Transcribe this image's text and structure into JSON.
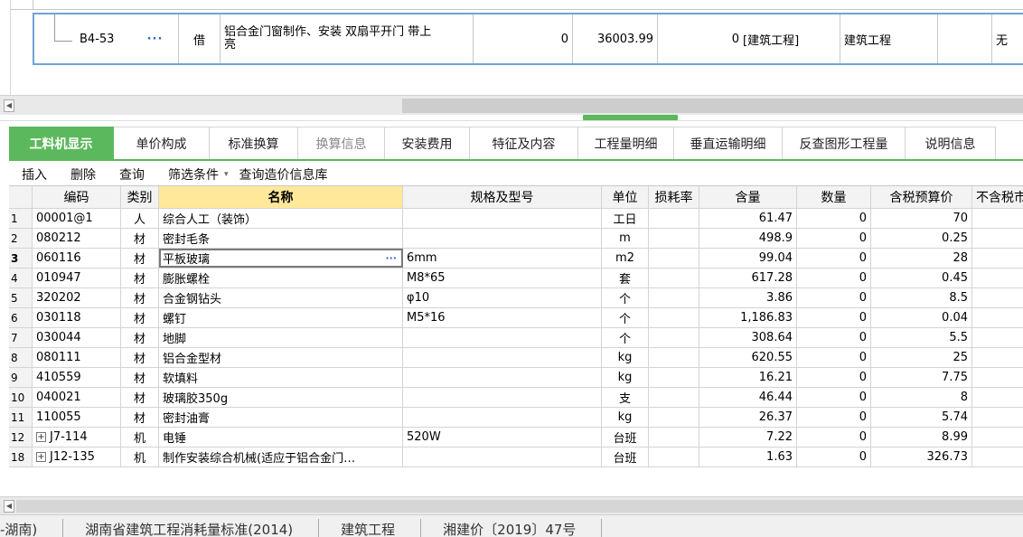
{
  "top_row": {
    "code": "B4-53",
    "dots": "···",
    "type": "借",
    "name_line1": "铝合金门窗制作、安装 双扇平开门 带上",
    "name_line2": "亮",
    "v1": "0",
    "v2": "36003.99",
    "v3": "0",
    "category": "[建筑工程]",
    "discipline": "建筑工程",
    "last": "无"
  },
  "tabs": [
    {
      "label": "工料机显示"
    },
    {
      "label": "单价构成"
    },
    {
      "label": "标准换算"
    },
    {
      "label": "换算信息"
    },
    {
      "label": "安装费用"
    },
    {
      "label": "特征及内容"
    },
    {
      "label": "工程量明细"
    },
    {
      "label": "垂直运输明细"
    },
    {
      "label": "反查图形工程量"
    },
    {
      "label": "说明信息"
    }
  ],
  "toolbar": {
    "insert": "插入",
    "delete": "删除",
    "query": "查询",
    "filter": "筛选条件",
    "caret": "▾",
    "query_price": "查询造价信息库"
  },
  "columns": {
    "code": "编码",
    "type": "类别",
    "name": "名称",
    "spec": "规格及型号",
    "unit": "单位",
    "loss": "损耗率",
    "content": "含量",
    "qty": "数量",
    "tax_price": "含税预算价",
    "notax_price": "不含税市"
  },
  "rows": [
    {
      "no": "1",
      "code": "00001@1",
      "type": "人",
      "name": "综合人工（装饰）",
      "spec": "",
      "unit": "工日",
      "content": "61.47",
      "qty": "0",
      "price": "70",
      "extra": ""
    },
    {
      "no": "2",
      "code": "080212",
      "type": "材",
      "name": "密封毛条",
      "spec": "",
      "unit": "m",
      "content": "498.9",
      "qty": "0",
      "price": "0.25",
      "extra": ""
    },
    {
      "no": "3",
      "code": "060116",
      "type": "材",
      "name": "平板玻璃",
      "spec": "6mm",
      "unit": "m2",
      "content": "99.04",
      "qty": "0",
      "price": "28",
      "extra": ""
    },
    {
      "no": "4",
      "code": "010947",
      "type": "材",
      "name": "膨胀螺栓",
      "spec": "M8*65",
      "unit": "套",
      "content": "617.28",
      "qty": "0",
      "price": "0.45",
      "extra": ""
    },
    {
      "no": "5",
      "code": "320202",
      "type": "材",
      "name": "合金钢钻头",
      "spec": "φ10",
      "unit": "个",
      "content": "3.86",
      "qty": "0",
      "price": "8.5",
      "extra": ""
    },
    {
      "no": "6",
      "code": "030118",
      "type": "材",
      "name": "螺钉",
      "spec": "M5*16",
      "unit": "个",
      "content": "1,186.83",
      "qty": "0",
      "price": "0.04",
      "extra": ""
    },
    {
      "no": "7",
      "code": "030044",
      "type": "材",
      "name": "地脚",
      "spec": "",
      "unit": "个",
      "content": "308.64",
      "qty": "0",
      "price": "5.5",
      "extra": ""
    },
    {
      "no": "8",
      "code": "080111",
      "type": "材",
      "name": "铝合金型材",
      "spec": "",
      "unit": "kg",
      "content": "620.55",
      "qty": "0",
      "price": "25",
      "extra": "2"
    },
    {
      "no": "9",
      "code": "410559",
      "type": "材",
      "name": "软填料",
      "spec": "",
      "unit": "kg",
      "content": "16.21",
      "qty": "0",
      "price": "7.75",
      "extra": ""
    },
    {
      "no": "10",
      "code": "040021",
      "type": "材",
      "name": "玻璃胶350g",
      "spec": "",
      "unit": "支",
      "content": "46.44",
      "qty": "0",
      "price": "8",
      "extra": ""
    },
    {
      "no": "11",
      "code": "110055",
      "type": "材",
      "name": "密封油膏",
      "spec": "",
      "unit": "kg",
      "content": "26.37",
      "qty": "0",
      "price": "5.74",
      "extra": ""
    },
    {
      "no": "12",
      "code": "J7-114",
      "type": "机",
      "name": "电锤",
      "spec": "520W",
      "unit": "台班",
      "content": "7.22",
      "qty": "0",
      "price": "8.99",
      "extra": ""
    },
    {
      "no": "18",
      "code": "J12-135",
      "type": "机",
      "name": "制作安装综合机械(适应于铝合金门…",
      "spec": "",
      "unit": "台班",
      "content": "1.63",
      "qty": "0",
      "price": "326.73",
      "extra": "2"
    }
  ],
  "cell_dots": "···",
  "expand_symbol": "+",
  "scroll_arrow": "◀",
  "status": {
    "region": "-湖南)",
    "standard": "湖南省建筑工程消耗量标准(2014)",
    "discipline": "建筑工程",
    "doc": "湘建价〔2019〕47号"
  },
  "colors": {
    "accent_green": "#5cb85c",
    "header_highlight": "#ffe89a",
    "selection_border": "#6fa3d6"
  }
}
